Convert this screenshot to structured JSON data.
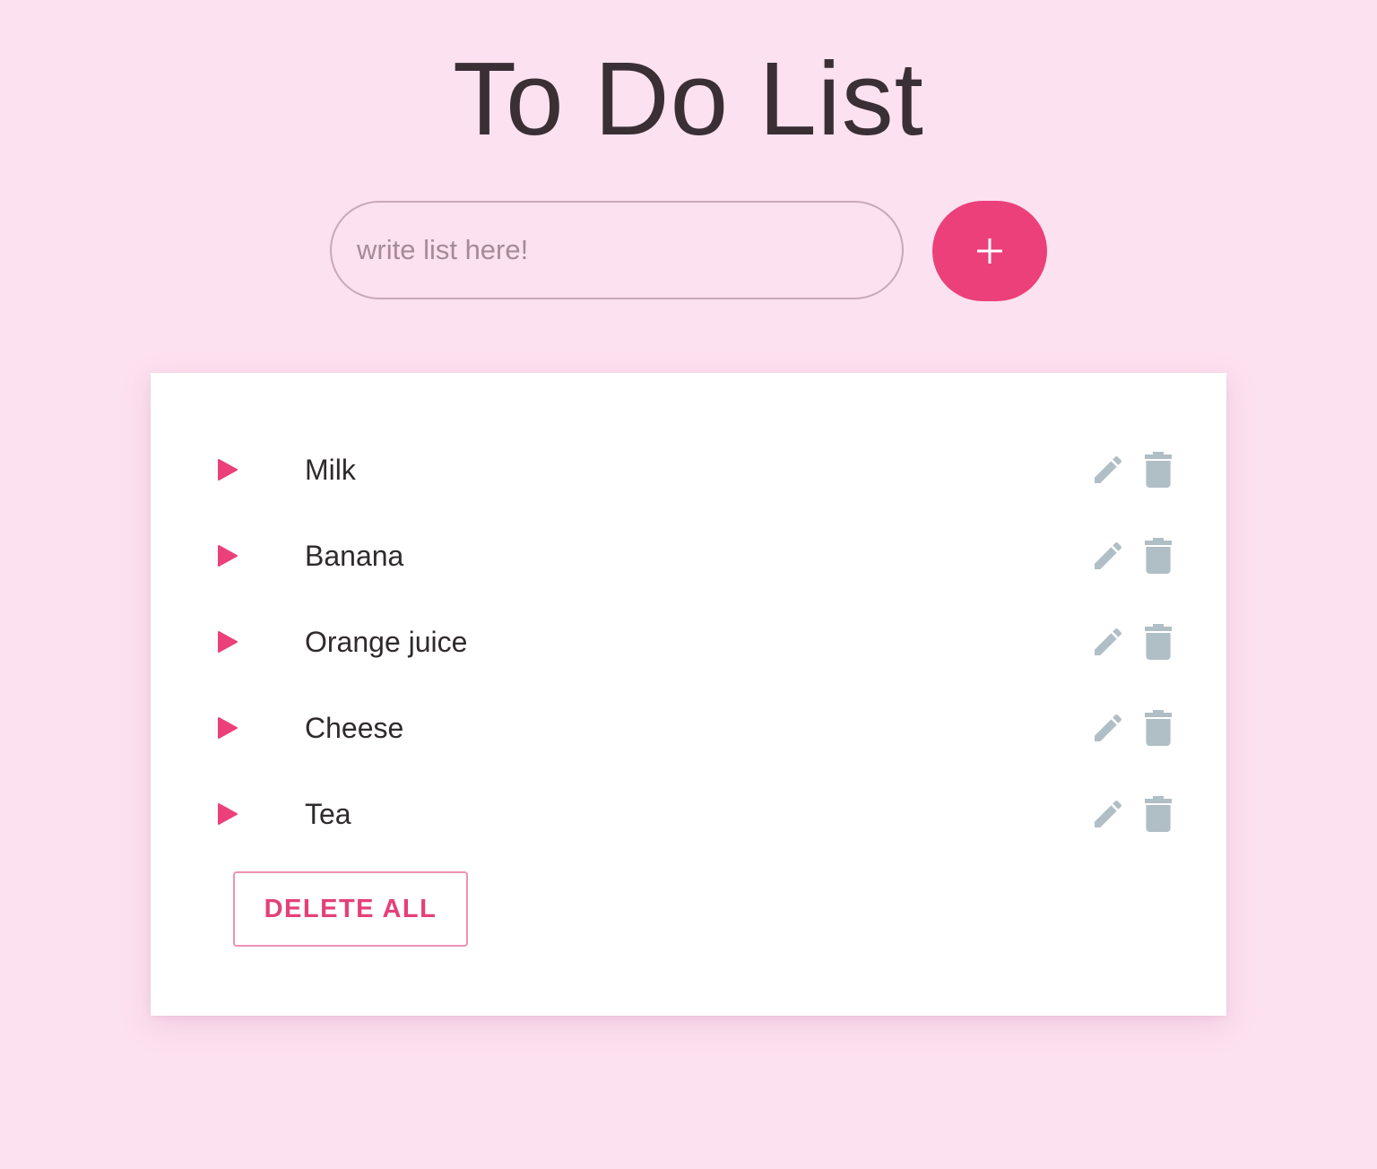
{
  "header": {
    "title": "To Do List"
  },
  "form": {
    "input_value": "",
    "input_placeholder": "write list here!",
    "add_icon": "plus-icon"
  },
  "list": {
    "items": [
      {
        "label": "Milk"
      },
      {
        "label": "Banana"
      },
      {
        "label": "Orange juice"
      },
      {
        "label": "Cheese"
      },
      {
        "label": "Tea"
      }
    ],
    "item_icons": {
      "bullet": "play-arrow-icon",
      "edit": "pencil-icon",
      "delete": "trash-icon"
    },
    "delete_all_label": "DELETE ALL"
  },
  "colors": {
    "background": "#fce1f0",
    "accent": "#ec407a",
    "icon_gray": "#b0bec5",
    "card": "#ffffff"
  }
}
